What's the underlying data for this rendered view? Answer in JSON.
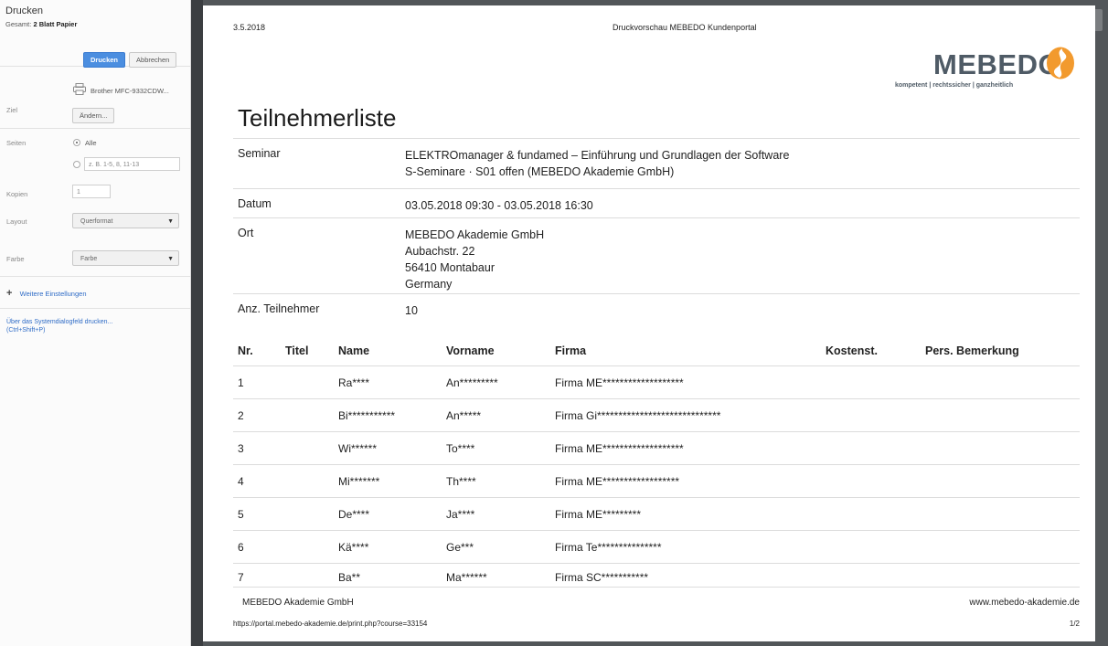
{
  "panel": {
    "title": "Drucken",
    "total_prefix": "Gesamt:",
    "total_value": "2 Blatt Papier",
    "print_button": "Drucken",
    "cancel_button": "Abbrechen",
    "destination_label": "Ziel",
    "printer_name": "Brother MFC-9332CDW...",
    "change_button": "Ändern...",
    "pages_label": "Seiten",
    "pages_all": "Alle",
    "pages_placeholder": "z. B. 1-5, 8, 11-13",
    "copies_label": "Kopien",
    "copies_value": "1",
    "layout_label": "Layout",
    "layout_value": "Querformat",
    "color_label": "Farbe",
    "color_value": "Farbe",
    "more_settings": "Weitere Einstellungen",
    "system_dialog_line1": "Über das Systemdialogfeld drucken...",
    "system_dialog_line2": "(Ctrl+Shift+P)"
  },
  "preview": {
    "page_badge": "1",
    "header_date": "3.5.2018",
    "header_title": "Druckvorschau MEBEDO Kundenportal",
    "logo_text": "MEBEDO",
    "logo_tagline": "kompetent | rechtssicher | ganzheitlich",
    "heading": "Teilnehmerliste",
    "info": {
      "seminar_label": "Seminar",
      "seminar_line1": "ELEKTROmanager & fundamed – Einführung und Grundlagen der Software",
      "seminar_line2": "S-Seminare · S01 offen (MEBEDO Akademie GmbH)",
      "date_label": "Datum",
      "date_value": "03.05.2018 09:30 - 03.05.2018 16:30",
      "place_label": "Ort",
      "place_line1": "MEBEDO Akademie GmbH",
      "place_line2": "Aubachstr. 22",
      "place_line3": "56410 Montabaur",
      "place_line4": "Germany",
      "count_label": "Anz. Teilnehmer",
      "count_value": "10"
    },
    "columns": {
      "nr": "Nr.",
      "title": "Titel",
      "name": "Name",
      "firstname": "Vorname",
      "company": "Firma",
      "cost": "Kostenst.",
      "remark": "Pers. Bemerkung"
    },
    "rows": [
      {
        "nr": "1",
        "name": "Ra****",
        "firstname": "An*********",
        "company": "Firma ME*******************"
      },
      {
        "nr": "2",
        "name": "Bi***********",
        "firstname": "An*****",
        "company": "Firma Gi*****************************"
      },
      {
        "nr": "3",
        "name": "Wi******",
        "firstname": "To****",
        "company": "Firma ME*******************"
      },
      {
        "nr": "4",
        "name": "Mi*******",
        "firstname": "Th****",
        "company": "Firma ME******************"
      },
      {
        "nr": "5",
        "name": "De****",
        "firstname": "Ja****",
        "company": "Firma ME*********"
      },
      {
        "nr": "6",
        "name": "Kä****",
        "firstname": "Ge***",
        "company": "Firma Te***************"
      },
      {
        "nr": "7",
        "name": "Ba**",
        "firstname": "Ma******",
        "company": "Firma SC***********"
      }
    ],
    "footer_company": "MEBEDO Akademie GmbH",
    "footer_web": "www.mebedo-akademie.de",
    "footer_url": "https://portal.mebedo-akademie.de/print.php?course=33154",
    "footer_page": "1/2"
  },
  "colors": {
    "accent_button": "#4b8ee0",
    "logo_orange": "#f29a2e",
    "logo_gray": "#4f5b66"
  }
}
